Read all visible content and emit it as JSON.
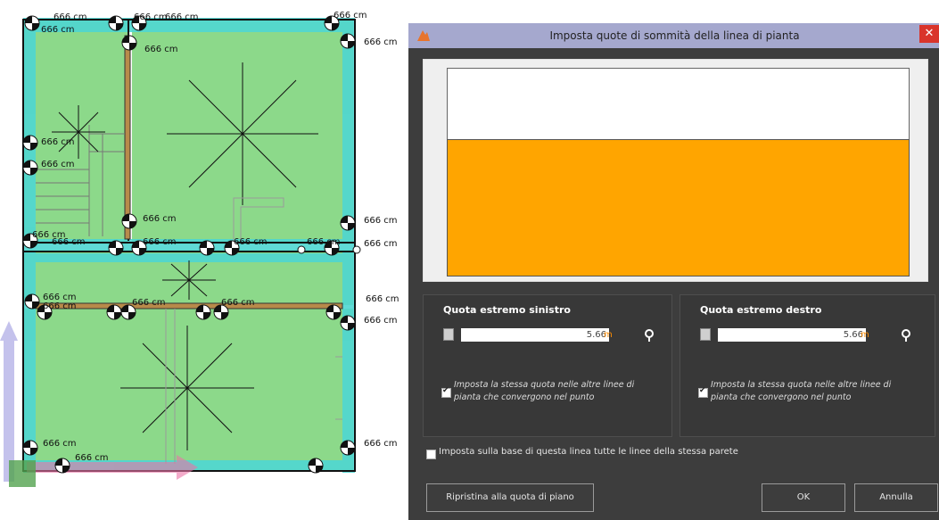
{
  "dialog": {
    "title": "Imposta quote di sommità della linea di pianta",
    "close_symbol": "✕",
    "app_icon": "app-logo-icon",
    "left_panel": {
      "title": "Quota estremo sinistro",
      "value": "5.66",
      "unit": "m",
      "checkbox_checked": true,
      "checkbox_label": "Imposta la stessa quota nelle altre linee di pianta che convergono nel punto"
    },
    "right_panel": {
      "title": "Quota estremo destro",
      "value": "5.66",
      "unit": "m",
      "checkbox_checked": true,
      "checkbox_label": "Imposta la stessa quota nelle altre linee di pianta che convergono nel punto"
    },
    "bottom_checkbox": {
      "checked": false,
      "label": "Imposta sulla base di questa linea tutte le linee della stessa parete"
    },
    "buttons": {
      "reset": "Ripristina alla quota di piano",
      "ok": "OK",
      "cancel": "Annulla"
    },
    "colors": {
      "preview_fill": "#ffa500",
      "title_bar": "#a5a8ce",
      "close": "#d9342b"
    }
  },
  "plan": {
    "dimension_labels": [
      "666 cm",
      "666 cm",
      "666 cm",
      "666 cm",
      "666 cm",
      "666 cm",
      "666 cm",
      "666 cm",
      "666 cm",
      "666 cm",
      "666 cm",
      "666 cm",
      "666 cm",
      "666 cm",
      "666 cm",
      "666 cm",
      "666 cm",
      "666 cm",
      "666 cm",
      "666 cm",
      "666 cm",
      "666 cm",
      "666 cm",
      "666 cm",
      "666 cm",
      "666 cm"
    ]
  }
}
